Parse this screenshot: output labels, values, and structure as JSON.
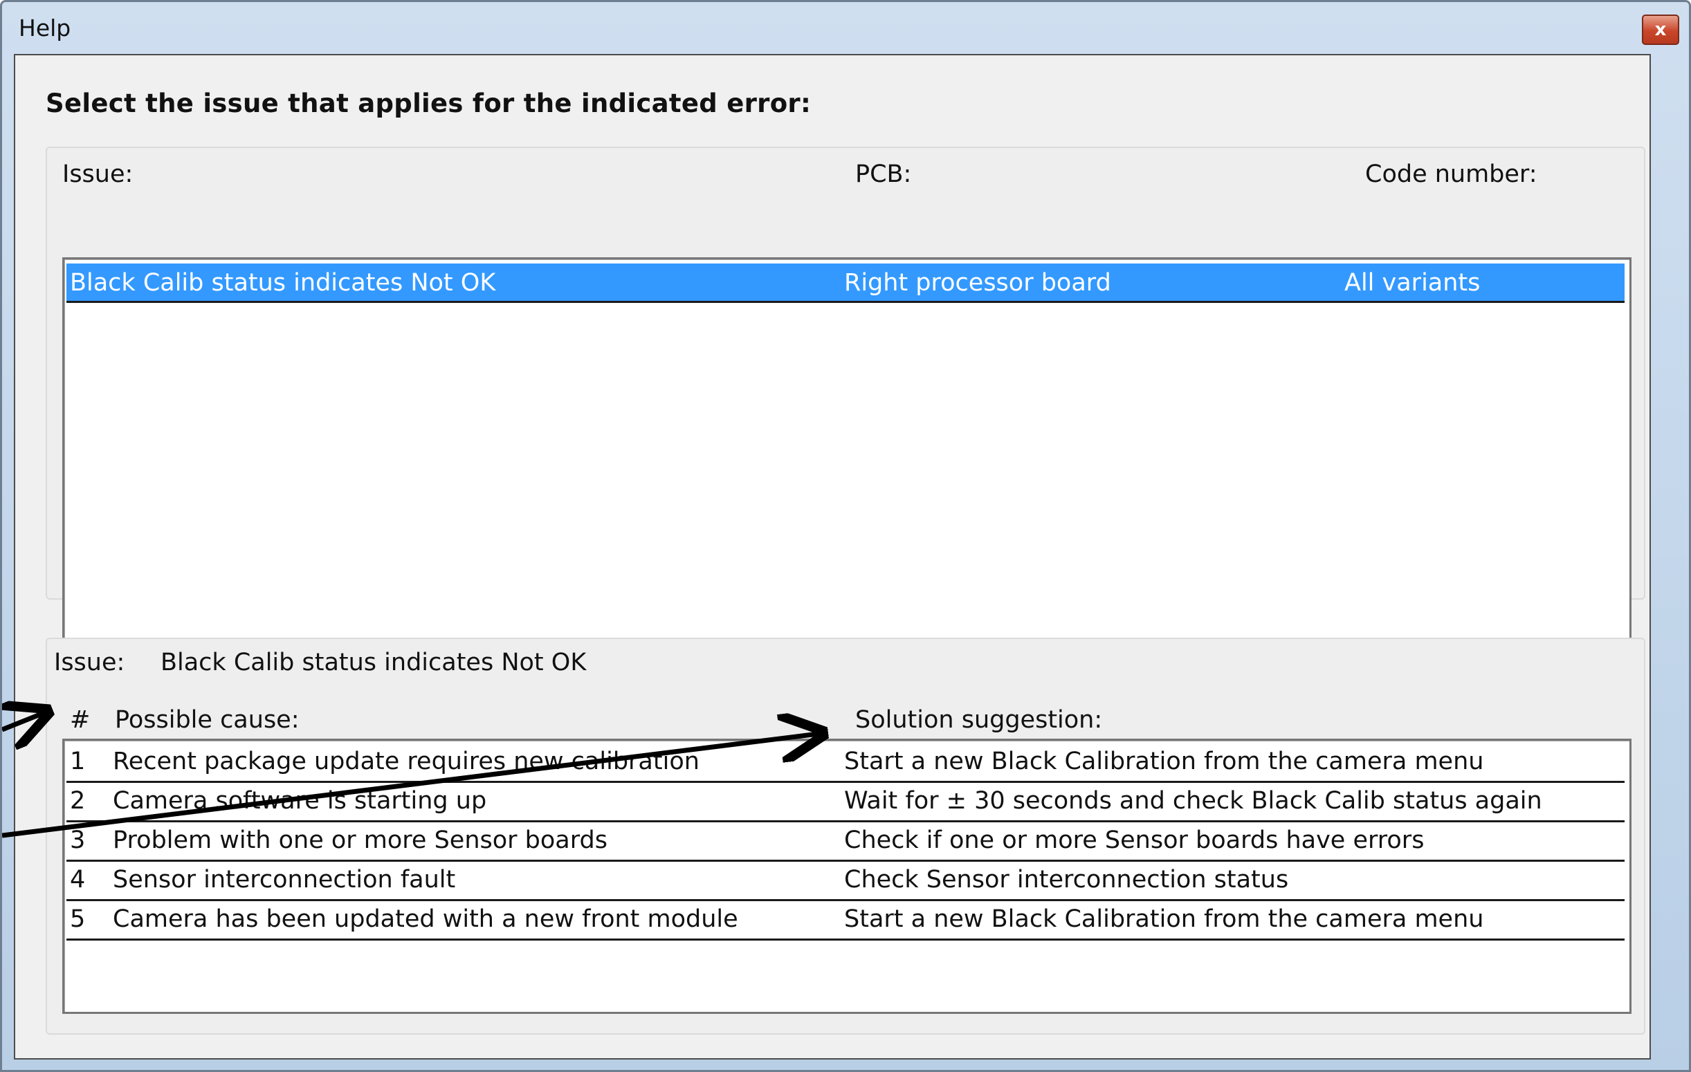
{
  "window": {
    "title": "Help",
    "close_symbol": "x"
  },
  "instruction": "Select the issue that applies for the indicated error:",
  "issue_list": {
    "headers": {
      "issue": "Issue:",
      "pcb": "PCB:",
      "code": "Code number:"
    },
    "rows": [
      {
        "issue": "Black Calib status indicates Not OK",
        "pcb": "Right processor board",
        "code": "All variants",
        "selected": true
      }
    ]
  },
  "details": {
    "issue_label": "Issue:",
    "issue_value": "Black Calib status indicates Not OK",
    "headers": {
      "num": "#",
      "cause": "Possible cause:",
      "solution": "Solution suggestion:"
    },
    "rows": [
      {
        "num": "1",
        "cause": "Recent package update requires new calibration",
        "solution": "Start a new Black Calibration from the camera menu"
      },
      {
        "num": "2",
        "cause": "Camera software is starting up",
        "solution": "Wait for ± 30 seconds and check Black Calib status again"
      },
      {
        "num": "3",
        "cause": "Problem with one or more Sensor boards",
        "solution": "Check if one or more Sensor boards have errors"
      },
      {
        "num": "4",
        "cause": "Sensor interconnection fault",
        "solution": "Check Sensor interconnection status"
      },
      {
        "num": "5",
        "cause": "Camera has been updated with a new front module",
        "solution": "Start a new Black Calibration from the camera menu"
      }
    ]
  },
  "colors": {
    "selection": "#3399ff",
    "client_bg": "#f0f0f0",
    "annotation_arrow": "#000000"
  }
}
